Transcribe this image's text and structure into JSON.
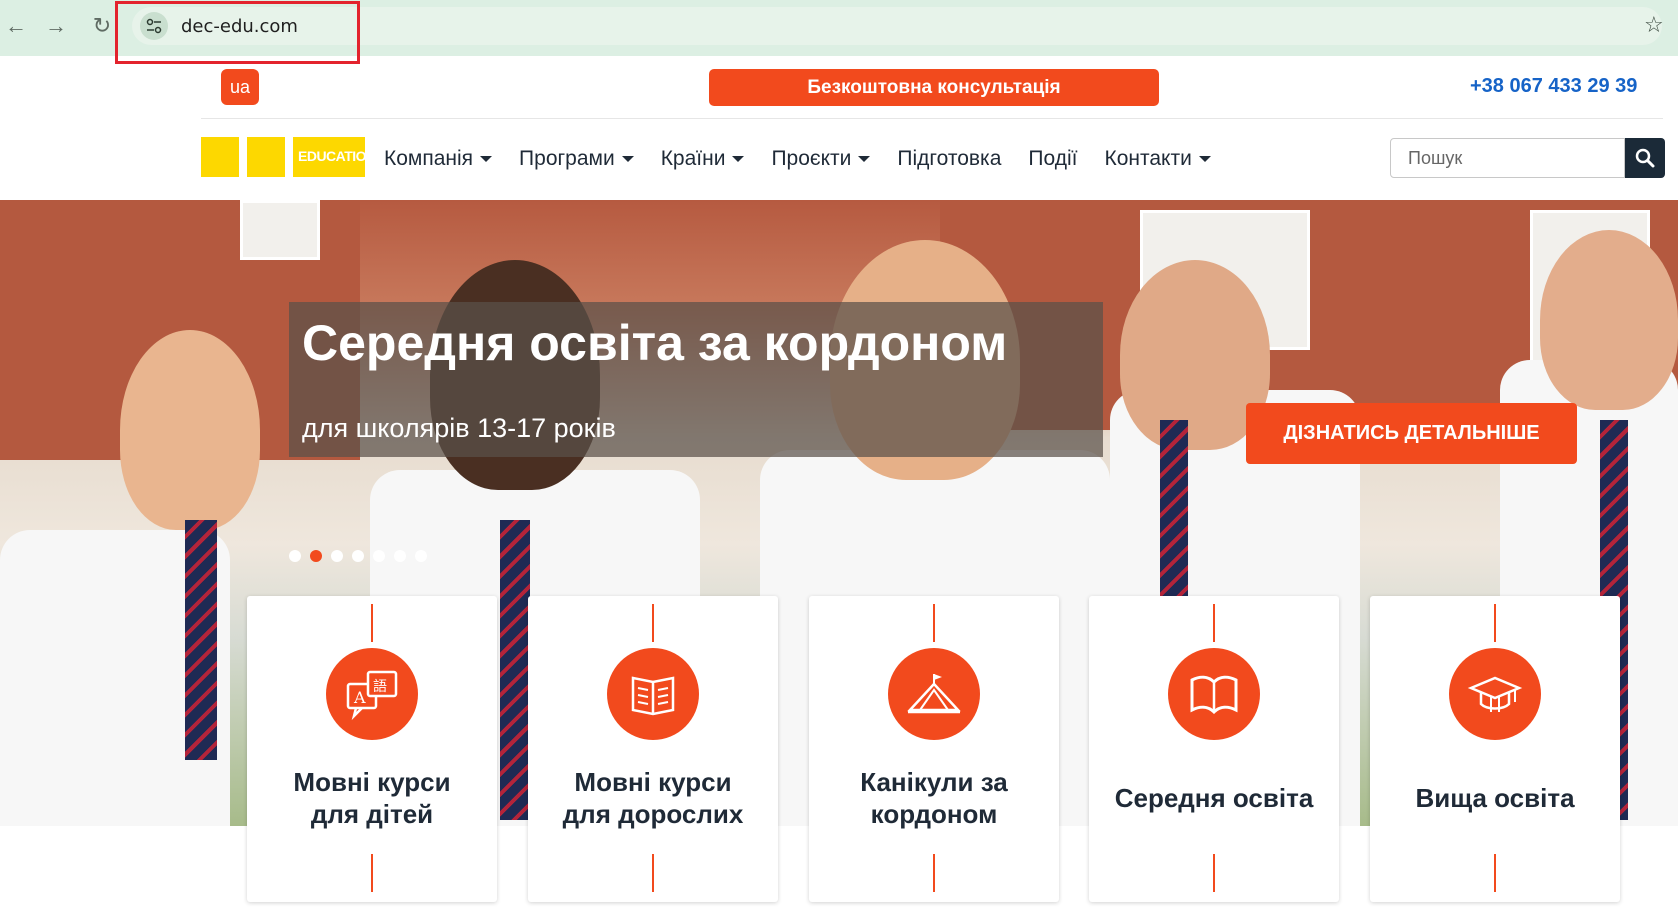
{
  "browser": {
    "url": "dec-edu.com"
  },
  "header": {
    "lang": "ua",
    "consult_label": "Безкоштовна консультація",
    "phone": "+38 067 433 29 39",
    "logo_text": "EDUCATION"
  },
  "menu": {
    "items": [
      {
        "label": "Компанія",
        "dropdown": true
      },
      {
        "label": "Програми",
        "dropdown": true
      },
      {
        "label": "Країни",
        "dropdown": true
      },
      {
        "label": "Проєкти",
        "dropdown": true
      },
      {
        "label": "Підготовка",
        "dropdown": false
      },
      {
        "label": "Події",
        "dropdown": false
      },
      {
        "label": "Контакти",
        "dropdown": true
      }
    ]
  },
  "search": {
    "placeholder": "Пошук",
    "value": ""
  },
  "hero": {
    "title": "Середня освіта за кордоном",
    "subtitle": "для школярів 13-17 років",
    "cta_label": "ДІЗНАТИСЬ ДЕТАЛЬНІШЕ",
    "slide_count": 7,
    "active_slide": 2
  },
  "cards": [
    {
      "line1": "Мовні курси",
      "line2": "для дітей",
      "icon": "language-translate-icon"
    },
    {
      "line1": "Мовні курси",
      "line2": "для дорослих",
      "icon": "book-open-icon"
    },
    {
      "line1": "Канікули за",
      "line2": "кордоном",
      "icon": "camp-tent-icon"
    },
    {
      "line1": "Середня освіта",
      "line2": "",
      "icon": "open-book-icon"
    },
    {
      "line1": "Вища освіта",
      "line2": "",
      "icon": "graduation-cap-icon"
    }
  ],
  "colors": {
    "accent": "#f24a1d",
    "phone": "#1663c7",
    "logo": "#fdd800",
    "dark": "#1b2a38"
  }
}
